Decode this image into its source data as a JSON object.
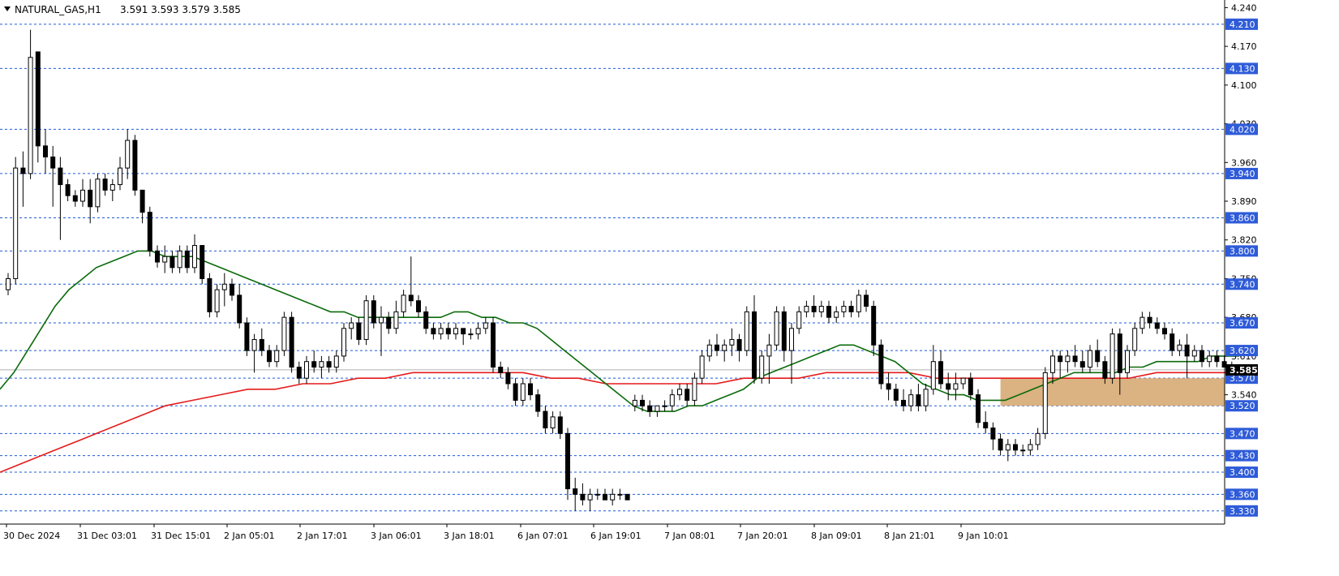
{
  "header": {
    "symbol": "NATURAL_GAS,H1",
    "ohlc": "3.591 3.593 3.579 3.585"
  },
  "colors": {
    "grid": "#1f5bd6",
    "current_price_line": "#b0b0b0",
    "ma_fast": "#0b6b0b",
    "ma_slow": "#e51b1b",
    "zone_fill": "#d9ae7a",
    "candle_body_bear": "#000000",
    "candle_body_bull": "#ffffff",
    "label_bg": "#2e5bd8"
  },
  "chart_data": {
    "type": "candlestick",
    "y_axis_ticks": [
      "4.240",
      "4.170",
      "4.100",
      "4.030",
      "3.960",
      "3.890",
      "3.820",
      "3.750",
      "3.680",
      "3.610",
      "3.540"
    ],
    "y_axis_ticks_values": [
      4.24,
      4.17,
      4.1,
      4.03,
      3.96,
      3.89,
      3.82,
      3.75,
      3.68,
      3.61,
      3.54
    ],
    "levels": [
      "4.210",
      "4.130",
      "4.020",
      "3.940",
      "3.860",
      "3.800",
      "3.740",
      "3.670",
      "3.620",
      "3.570",
      "3.520",
      "3.470",
      "3.430",
      "3.400",
      "3.360",
      "3.330"
    ],
    "current_price": "3.585",
    "x_labels": [
      "30 Dec 2024",
      "31 Dec 03:01",
      "31 Dec 15:01",
      "2 Jan 05:01",
      "2 Jan 17:01",
      "3 Jan 06:01",
      "3 Jan 18:01",
      "6 Jan 07:01",
      "6 Jan 19:01",
      "7 Jan 08:01",
      "7 Jan 20:01",
      "8 Jan 09:01",
      "8 Jan 21:01",
      "9 Jan 10:01"
    ],
    "zone": {
      "from_price": 3.52,
      "to_price": 3.57,
      "from_bar": 133,
      "to_bar": 163
    },
    "ylim": [
      3.31,
      4.25
    ],
    "candles": [
      [
        3.73,
        3.76,
        3.72,
        3.75
      ],
      [
        3.75,
        3.97,
        3.74,
        3.95
      ],
      [
        3.95,
        3.98,
        3.88,
        3.94
      ],
      [
        3.94,
        4.2,
        3.93,
        4.15
      ],
      [
        4.16,
        4.16,
        3.96,
        3.99
      ],
      [
        3.99,
        4.02,
        3.94,
        3.97
      ],
      [
        3.97,
        3.99,
        3.88,
        3.95
      ],
      [
        3.95,
        3.97,
        3.82,
        3.92
      ],
      [
        3.92,
        3.93,
        3.89,
        3.9
      ],
      [
        3.9,
        3.91,
        3.88,
        3.89
      ],
      [
        3.89,
        3.93,
        3.88,
        3.91
      ],
      [
        3.91,
        3.93,
        3.85,
        3.88
      ],
      [
        3.88,
        3.94,
        3.87,
        3.93
      ],
      [
        3.93,
        3.94,
        3.9,
        3.91
      ],
      [
        3.91,
        3.93,
        3.89,
        3.92
      ],
      [
        3.92,
        3.97,
        3.91,
        3.95
      ],
      [
        3.95,
        4.02,
        3.93,
        4.0
      ],
      [
        4.0,
        4.01,
        3.9,
        3.91
      ],
      [
        3.91,
        3.91,
        3.85,
        3.87
      ],
      [
        3.87,
        3.88,
        3.79,
        3.8
      ],
      [
        3.8,
        3.81,
        3.77,
        3.78
      ],
      [
        3.78,
        3.81,
        3.76,
        3.79
      ],
      [
        3.79,
        3.8,
        3.76,
        3.77
      ],
      [
        3.77,
        3.81,
        3.76,
        3.8
      ],
      [
        3.8,
        3.81,
        3.76,
        3.77
      ],
      [
        3.77,
        3.83,
        3.76,
        3.81
      ],
      [
        3.81,
        3.81,
        3.74,
        3.75
      ],
      [
        3.75,
        3.76,
        3.68,
        3.69
      ],
      [
        3.69,
        3.74,
        3.68,
        3.73
      ],
      [
        3.73,
        3.76,
        3.7,
        3.74
      ],
      [
        3.74,
        3.75,
        3.71,
        3.72
      ],
      [
        3.72,
        3.74,
        3.66,
        3.67
      ],
      [
        3.67,
        3.68,
        3.61,
        3.62
      ],
      [
        3.62,
        3.65,
        3.58,
        3.64
      ],
      [
        3.64,
        3.66,
        3.61,
        3.62
      ],
      [
        3.62,
        3.63,
        3.59,
        3.6
      ],
      [
        3.6,
        3.63,
        3.59,
        3.62
      ],
      [
        3.62,
        3.69,
        3.61,
        3.68
      ],
      [
        3.68,
        3.69,
        3.58,
        3.59
      ],
      [
        3.59,
        3.6,
        3.56,
        3.57
      ],
      [
        3.57,
        3.61,
        3.56,
        3.6
      ],
      [
        3.6,
        3.62,
        3.58,
        3.59
      ],
      [
        3.59,
        3.61,
        3.57,
        3.6
      ],
      [
        3.6,
        3.61,
        3.58,
        3.59
      ],
      [
        3.59,
        3.62,
        3.58,
        3.61
      ],
      [
        3.61,
        3.67,
        3.6,
        3.66
      ],
      [
        3.66,
        3.68,
        3.64,
        3.67
      ],
      [
        3.67,
        3.68,
        3.63,
        3.64
      ],
      [
        3.64,
        3.72,
        3.63,
        3.71
      ],
      [
        3.71,
        3.72,
        3.66,
        3.67
      ],
      [
        3.67,
        3.7,
        3.61,
        3.68
      ],
      [
        3.68,
        3.69,
        3.65,
        3.66
      ],
      [
        3.66,
        3.71,
        3.65,
        3.69
      ],
      [
        3.69,
        3.73,
        3.68,
        3.72
      ],
      [
        3.72,
        3.79,
        3.7,
        3.71
      ],
      [
        3.71,
        3.72,
        3.68,
        3.69
      ],
      [
        3.69,
        3.7,
        3.65,
        3.66
      ],
      [
        3.66,
        3.67,
        3.64,
        3.65
      ],
      [
        3.65,
        3.67,
        3.64,
        3.66
      ],
      [
        3.66,
        3.67,
        3.64,
        3.65
      ],
      [
        3.65,
        3.67,
        3.64,
        3.66
      ],
      [
        3.66,
        3.66,
        3.63,
        3.65
      ],
      [
        3.65,
        3.66,
        3.64,
        3.65
      ],
      [
        3.65,
        3.67,
        3.64,
        3.66
      ],
      [
        3.66,
        3.68,
        3.65,
        3.67
      ],
      [
        3.67,
        3.68,
        3.58,
        3.59
      ],
      [
        3.59,
        3.6,
        3.57,
        3.58
      ],
      [
        3.58,
        3.59,
        3.55,
        3.56
      ],
      [
        3.56,
        3.57,
        3.52,
        3.53
      ],
      [
        3.53,
        3.57,
        3.52,
        3.56
      ],
      [
        3.56,
        3.57,
        3.53,
        3.54
      ],
      [
        3.54,
        3.55,
        3.5,
        3.51
      ],
      [
        3.51,
        3.52,
        3.47,
        3.48
      ],
      [
        3.48,
        3.51,
        3.47,
        3.5
      ],
      [
        3.5,
        3.51,
        3.46,
        3.47
      ],
      [
        3.47,
        3.48,
        3.35,
        3.37
      ],
      [
        3.37,
        3.39,
        3.33,
        3.36
      ],
      [
        3.36,
        3.38,
        3.34,
        3.35
      ],
      [
        3.35,
        3.37,
        3.33,
        3.36
      ],
      [
        3.36,
        3.37,
        3.35,
        3.36
      ],
      [
        3.36,
        3.37,
        3.35,
        3.35
      ],
      [
        3.35,
        3.37,
        3.34,
        3.36
      ],
      [
        3.36,
        3.37,
        3.35,
        3.36
      ],
      [
        3.36,
        3.36,
        3.35,
        3.35
      ],
      [
        3.52,
        3.54,
        3.51,
        3.53
      ],
      [
        3.53,
        3.54,
        3.51,
        3.52
      ],
      [
        3.52,
        3.53,
        3.5,
        3.51
      ],
      [
        3.51,
        3.52,
        3.5,
        3.52
      ],
      [
        3.52,
        3.53,
        3.51,
        3.52
      ],
      [
        3.52,
        3.55,
        3.51,
        3.54
      ],
      [
        3.54,
        3.56,
        3.53,
        3.55
      ],
      [
        3.55,
        3.56,
        3.52,
        3.53
      ],
      [
        3.53,
        3.58,
        3.52,
        3.57
      ],
      [
        3.57,
        3.62,
        3.56,
        3.61
      ],
      [
        3.61,
        3.64,
        3.6,
        3.63
      ],
      [
        3.63,
        3.65,
        3.61,
        3.62
      ],
      [
        3.62,
        3.64,
        3.6,
        3.63
      ],
      [
        3.63,
        3.66,
        3.61,
        3.64
      ],
      [
        3.64,
        3.65,
        3.6,
        3.62
      ],
      [
        3.62,
        3.7,
        3.61,
        3.69
      ],
      [
        3.69,
        3.72,
        3.56,
        3.57
      ],
      [
        3.57,
        3.62,
        3.56,
        3.61
      ],
      [
        3.61,
        3.65,
        3.56,
        3.63
      ],
      [
        3.63,
        3.7,
        3.62,
        3.69
      ],
      [
        3.69,
        3.7,
        3.6,
        3.62
      ],
      [
        3.62,
        3.67,
        3.56,
        3.66
      ],
      [
        3.66,
        3.7,
        3.65,
        3.69
      ],
      [
        3.69,
        3.71,
        3.68,
        3.7
      ],
      [
        3.7,
        3.72,
        3.68,
        3.69
      ],
      [
        3.69,
        3.71,
        3.68,
        3.7
      ],
      [
        3.7,
        3.71,
        3.67,
        3.68
      ],
      [
        3.68,
        3.7,
        3.67,
        3.69
      ],
      [
        3.69,
        3.71,
        3.68,
        3.7
      ],
      [
        3.7,
        3.71,
        3.68,
        3.69
      ],
      [
        3.69,
        3.73,
        3.68,
        3.72
      ],
      [
        3.72,
        3.73,
        3.69,
        3.7
      ],
      [
        3.7,
        3.71,
        3.61,
        3.63
      ],
      [
        3.63,
        3.64,
        3.55,
        3.56
      ],
      [
        3.56,
        3.58,
        3.53,
        3.55
      ],
      [
        3.55,
        3.56,
        3.52,
        3.53
      ],
      [
        3.53,
        3.55,
        3.51,
        3.52
      ],
      [
        3.52,
        3.55,
        3.51,
        3.54
      ],
      [
        3.54,
        3.56,
        3.51,
        3.52
      ],
      [
        3.52,
        3.56,
        3.51,
        3.55
      ],
      [
        3.55,
        3.63,
        3.54,
        3.6
      ],
      [
        3.6,
        3.62,
        3.55,
        3.56
      ],
      [
        3.56,
        3.58,
        3.53,
        3.55
      ],
      [
        3.55,
        3.58,
        3.53,
        3.56
      ],
      [
        3.56,
        3.57,
        3.55,
        3.57
      ],
      [
        3.57,
        3.58,
        3.53,
        3.54
      ],
      [
        3.54,
        3.55,
        3.48,
        3.49
      ],
      [
        3.49,
        3.51,
        3.47,
        3.48
      ],
      [
        3.48,
        3.49,
        3.44,
        3.46
      ],
      [
        3.46,
        3.47,
        3.43,
        3.44
      ],
      [
        3.44,
        3.46,
        3.42,
        3.45
      ],
      [
        3.45,
        3.46,
        3.43,
        3.44
      ],
      [
        3.44,
        3.45,
        3.43,
        3.44
      ],
      [
        3.44,
        3.46,
        3.43,
        3.45
      ],
      [
        3.45,
        3.48,
        3.44,
        3.47
      ],
      [
        3.47,
        3.59,
        3.46,
        3.58
      ],
      [
        3.58,
        3.62,
        3.56,
        3.61
      ],
      [
        3.61,
        3.62,
        3.57,
        3.6
      ],
      [
        3.6,
        3.62,
        3.58,
        3.61
      ],
      [
        3.61,
        3.63,
        3.59,
        3.6
      ],
      [
        3.6,
        3.62,
        3.58,
        3.59
      ],
      [
        3.59,
        3.63,
        3.58,
        3.62
      ],
      [
        3.62,
        3.64,
        3.59,
        3.6
      ],
      [
        3.6,
        3.61,
        3.56,
        3.57
      ],
      [
        3.57,
        3.66,
        3.56,
        3.65
      ],
      [
        3.65,
        3.66,
        3.54,
        3.58
      ],
      [
        3.58,
        3.63,
        3.57,
        3.62
      ],
      [
        3.62,
        3.67,
        3.61,
        3.66
      ],
      [
        3.66,
        3.69,
        3.65,
        3.68
      ],
      [
        3.68,
        3.69,
        3.66,
        3.67
      ],
      [
        3.67,
        3.68,
        3.65,
        3.66
      ],
      [
        3.66,
        3.67,
        3.64,
        3.65
      ],
      [
        3.65,
        3.66,
        3.61,
        3.62
      ],
      [
        3.62,
        3.64,
        3.61,
        3.63
      ],
      [
        3.63,
        3.65,
        3.57,
        3.61
      ],
      [
        3.61,
        3.63,
        3.6,
        3.62
      ],
      [
        3.62,
        3.63,
        3.59,
        3.6
      ],
      [
        3.6,
        3.62,
        3.59,
        3.61
      ],
      [
        3.61,
        3.62,
        3.59,
        3.6
      ],
      [
        3.6,
        3.61,
        3.59,
        3.59
      ],
      [
        3.59,
        3.6,
        3.58,
        3.59
      ],
      [
        3.59,
        3.59,
        3.58,
        3.585
      ]
    ],
    "ma_fast": [
      3.55,
      3.58,
      3.62,
      3.66,
      3.7,
      3.73,
      3.75,
      3.77,
      3.78,
      3.79,
      3.8,
      3.8,
      3.79,
      3.79,
      3.79,
      3.78,
      3.77,
      3.76,
      3.75,
      3.74,
      3.73,
      3.72,
      3.71,
      3.7,
      3.69,
      3.69,
      3.68,
      3.68,
      3.68,
      3.68,
      3.68,
      3.68,
      3.68,
      3.69,
      3.69,
      3.68,
      3.68,
      3.67,
      3.67,
      3.66,
      3.64,
      3.62,
      3.6,
      3.58,
      3.56,
      3.54,
      3.52,
      3.51,
      3.51,
      3.51,
      3.52,
      3.52,
      3.53,
      3.54,
      3.55,
      3.57,
      3.58,
      3.59,
      3.6,
      3.61,
      3.62,
      3.63,
      3.63,
      3.62,
      3.61,
      3.6,
      3.58,
      3.56,
      3.55,
      3.54,
      3.54,
      3.53,
      3.53,
      3.53,
      3.54,
      3.55,
      3.56,
      3.57,
      3.58,
      3.58,
      3.58,
      3.58,
      3.59,
      3.59,
      3.6,
      3.6,
      3.6,
      3.6,
      3.61,
      3.61,
      3.61
    ],
    "ma_slow": [
      3.4,
      3.42,
      3.44,
      3.46,
      3.48,
      3.5,
      3.52,
      3.53,
      3.54,
      3.55,
      3.55,
      3.56,
      3.56,
      3.57,
      3.57,
      3.58,
      3.58,
      3.58,
      3.58,
      3.58,
      3.57,
      3.57,
      3.56,
      3.56,
      3.56,
      3.56,
      3.56,
      3.57,
      3.57,
      3.57,
      3.58,
      3.58,
      3.58,
      3.58,
      3.57,
      3.57,
      3.57,
      3.57,
      3.57,
      3.57,
      3.57,
      3.57,
      3.58,
      3.58,
      3.58,
      3.58
    ]
  }
}
